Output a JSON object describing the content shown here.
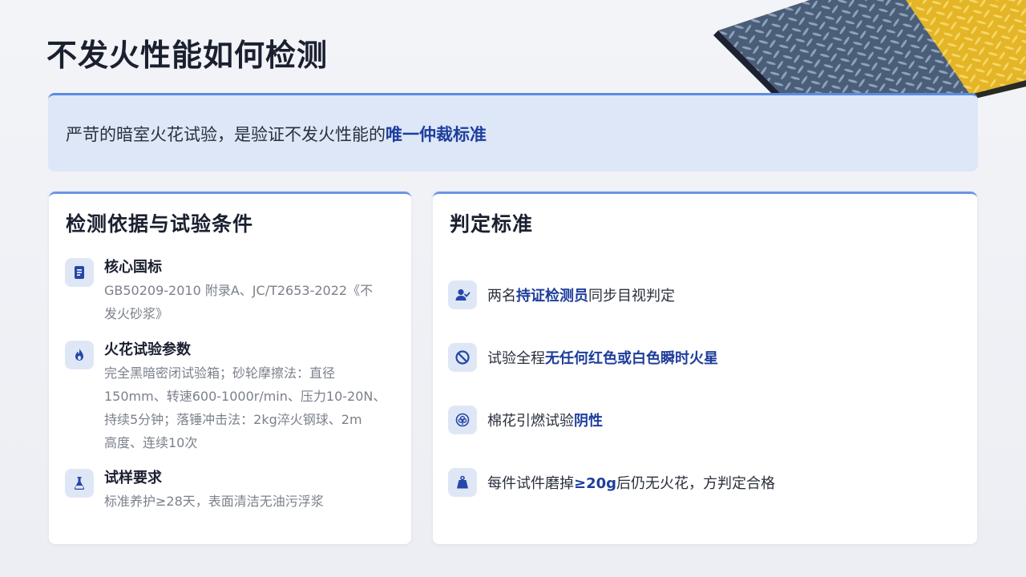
{
  "title": "不发火性能如何检测",
  "banner": {
    "text": "严苛的暗室火花试验，是验证不发火性能的",
    "highlight": "唯一仲裁标准"
  },
  "left_card": {
    "heading": "检测依据与试验条件",
    "items": [
      {
        "icon": "book-icon",
        "title": "核心国标",
        "lines": [
          "GB50209-2010 附录A、JC/T2653-2022《不",
          "发火砂浆》"
        ]
      },
      {
        "icon": "fire-icon",
        "title": "火花试验参数",
        "lines": [
          "完全黑暗密闭试验箱；砂轮摩擦法：直径",
          "150mm、转速600-1000r/min、压力10-20N、",
          "持续5分钟；落锤冲击法：2kg淬火钢球、2m",
          "高度、连续10次"
        ]
      },
      {
        "icon": "flask-icon",
        "title": "试样要求",
        "lines": [
          "标准养护≥28天，表面清洁无油污浮浆"
        ]
      }
    ]
  },
  "right_card": {
    "heading": "判定标准",
    "criteria": [
      {
        "icon": "user-check-icon",
        "pre": "两名",
        "bold": "持证检测员",
        "post": "同步目视判定"
      },
      {
        "icon": "ban-icon",
        "pre": "试验全程",
        "bold": "无任何红色或白色瞬时火星",
        "post": ""
      },
      {
        "icon": "cotton-icon",
        "pre": "棉花引燃试验",
        "bold": "阴性",
        "post": ""
      },
      {
        "icon": "weight-icon",
        "pre": "每件试件磨掉",
        "bold": "≥20g",
        "post": "后仍无火花，方判定合格"
      }
    ]
  },
  "colors": {
    "accent": "#1e3e9c",
    "banner_bg": "#dde7f8",
    "icon_bg": "#dfe7f7",
    "border": "#6b95e6"
  }
}
